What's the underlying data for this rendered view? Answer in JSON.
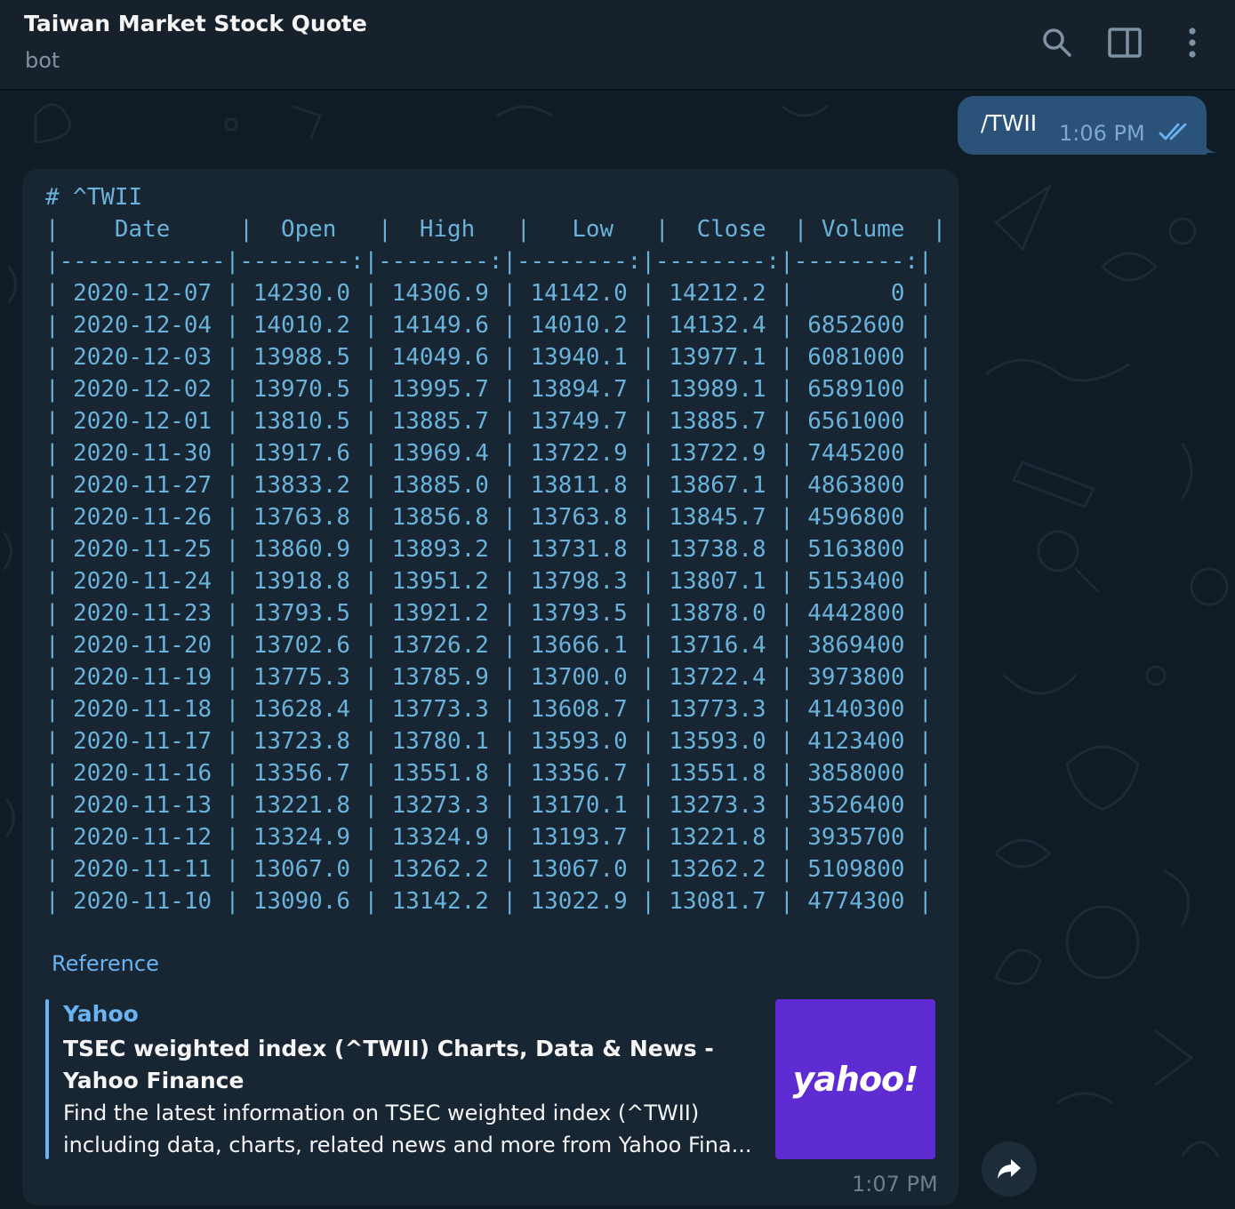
{
  "header": {
    "title": "Taiwan Market Stock Quote",
    "subtitle": "bot",
    "icons": [
      "search-icon",
      "sidebar-toggle-icon",
      "more-vertical-icon"
    ]
  },
  "outgoing": {
    "text": "/TWII",
    "time": "1:06 PM",
    "status": "read"
  },
  "incoming": {
    "table_lines": [
      "# ^TWII",
      "|    Date     |  Open   |  High   |   Low   |  Close  | Volume  |",
      "|------------|--------:|--------:|--------:|--------:|--------:|",
      "| 2020-12-07 | 14230.0 | 14306.9 | 14142.0 | 14212.2 |       0 |",
      "| 2020-12-04 | 14010.2 | 14149.6 | 14010.2 | 14132.4 | 6852600 |",
      "| 2020-12-03 | 13988.5 | 14049.6 | 13940.1 | 13977.1 | 6081000 |",
      "| 2020-12-02 | 13970.5 | 13995.7 | 13894.7 | 13989.1 | 6589100 |",
      "| 2020-12-01 | 13810.5 | 13885.7 | 13749.7 | 13885.7 | 6561000 |",
      "| 2020-11-30 | 13917.6 | 13969.4 | 13722.9 | 13722.9 | 7445200 |",
      "| 2020-11-27 | 13833.2 | 13885.0 | 13811.8 | 13867.1 | 4863800 |",
      "| 2020-11-26 | 13763.8 | 13856.8 | 13763.8 | 13845.7 | 4596800 |",
      "| 2020-11-25 | 13860.9 | 13893.2 | 13731.8 | 13738.8 | 5163800 |",
      "| 2020-11-24 | 13918.8 | 13951.2 | 13798.3 | 13807.1 | 5153400 |",
      "| 2020-11-23 | 13793.5 | 13921.2 | 13793.5 | 13878.0 | 4442800 |",
      "| 2020-11-20 | 13702.6 | 13726.2 | 13666.1 | 13716.4 | 3869400 |",
      "| 2020-11-19 | 13775.3 | 13785.9 | 13700.0 | 13722.4 | 3973800 |",
      "| 2020-11-18 | 13628.4 | 13773.3 | 13608.7 | 13773.3 | 4140300 |",
      "| 2020-11-17 | 13723.8 | 13780.1 | 13593.0 | 13593.0 | 4123400 |",
      "| 2020-11-16 | 13356.7 | 13551.8 | 13356.7 | 13551.8 | 3858000 |",
      "| 2020-11-13 | 13221.8 | 13273.3 | 13170.1 | 13273.3 | 3526400 |",
      "| 2020-11-12 | 13324.9 | 13324.9 | 13193.7 | 13221.8 | 3935700 |",
      "| 2020-11-11 | 13067.0 | 13262.2 | 13067.0 | 13262.2 | 5109800 |",
      "| 2020-11-10 | 13090.6 | 13142.2 | 13022.9 | 13081.7 | 4774300 |"
    ],
    "reference_label": "Reference",
    "preview": {
      "site": "Yahoo",
      "title": "TSEC weighted index (^TWII) Charts, Data & News - Yahoo Finance",
      "description": "Find the latest information on TSEC weighted index (^TWII) including data, charts, related news and more from Yahoo Fina...",
      "thumb_logo": "yahoo!",
      "thumb_color": "#5f2bd3"
    },
    "time": "1:07 PM"
  },
  "colors": {
    "header_bg": "#17212b",
    "chat_bg": "#0f1c26",
    "incoming_bubble": "#182533",
    "outgoing_bubble": "#2b5278",
    "mono_text": "#6ab2d9",
    "link": "#6ab3f3"
  }
}
